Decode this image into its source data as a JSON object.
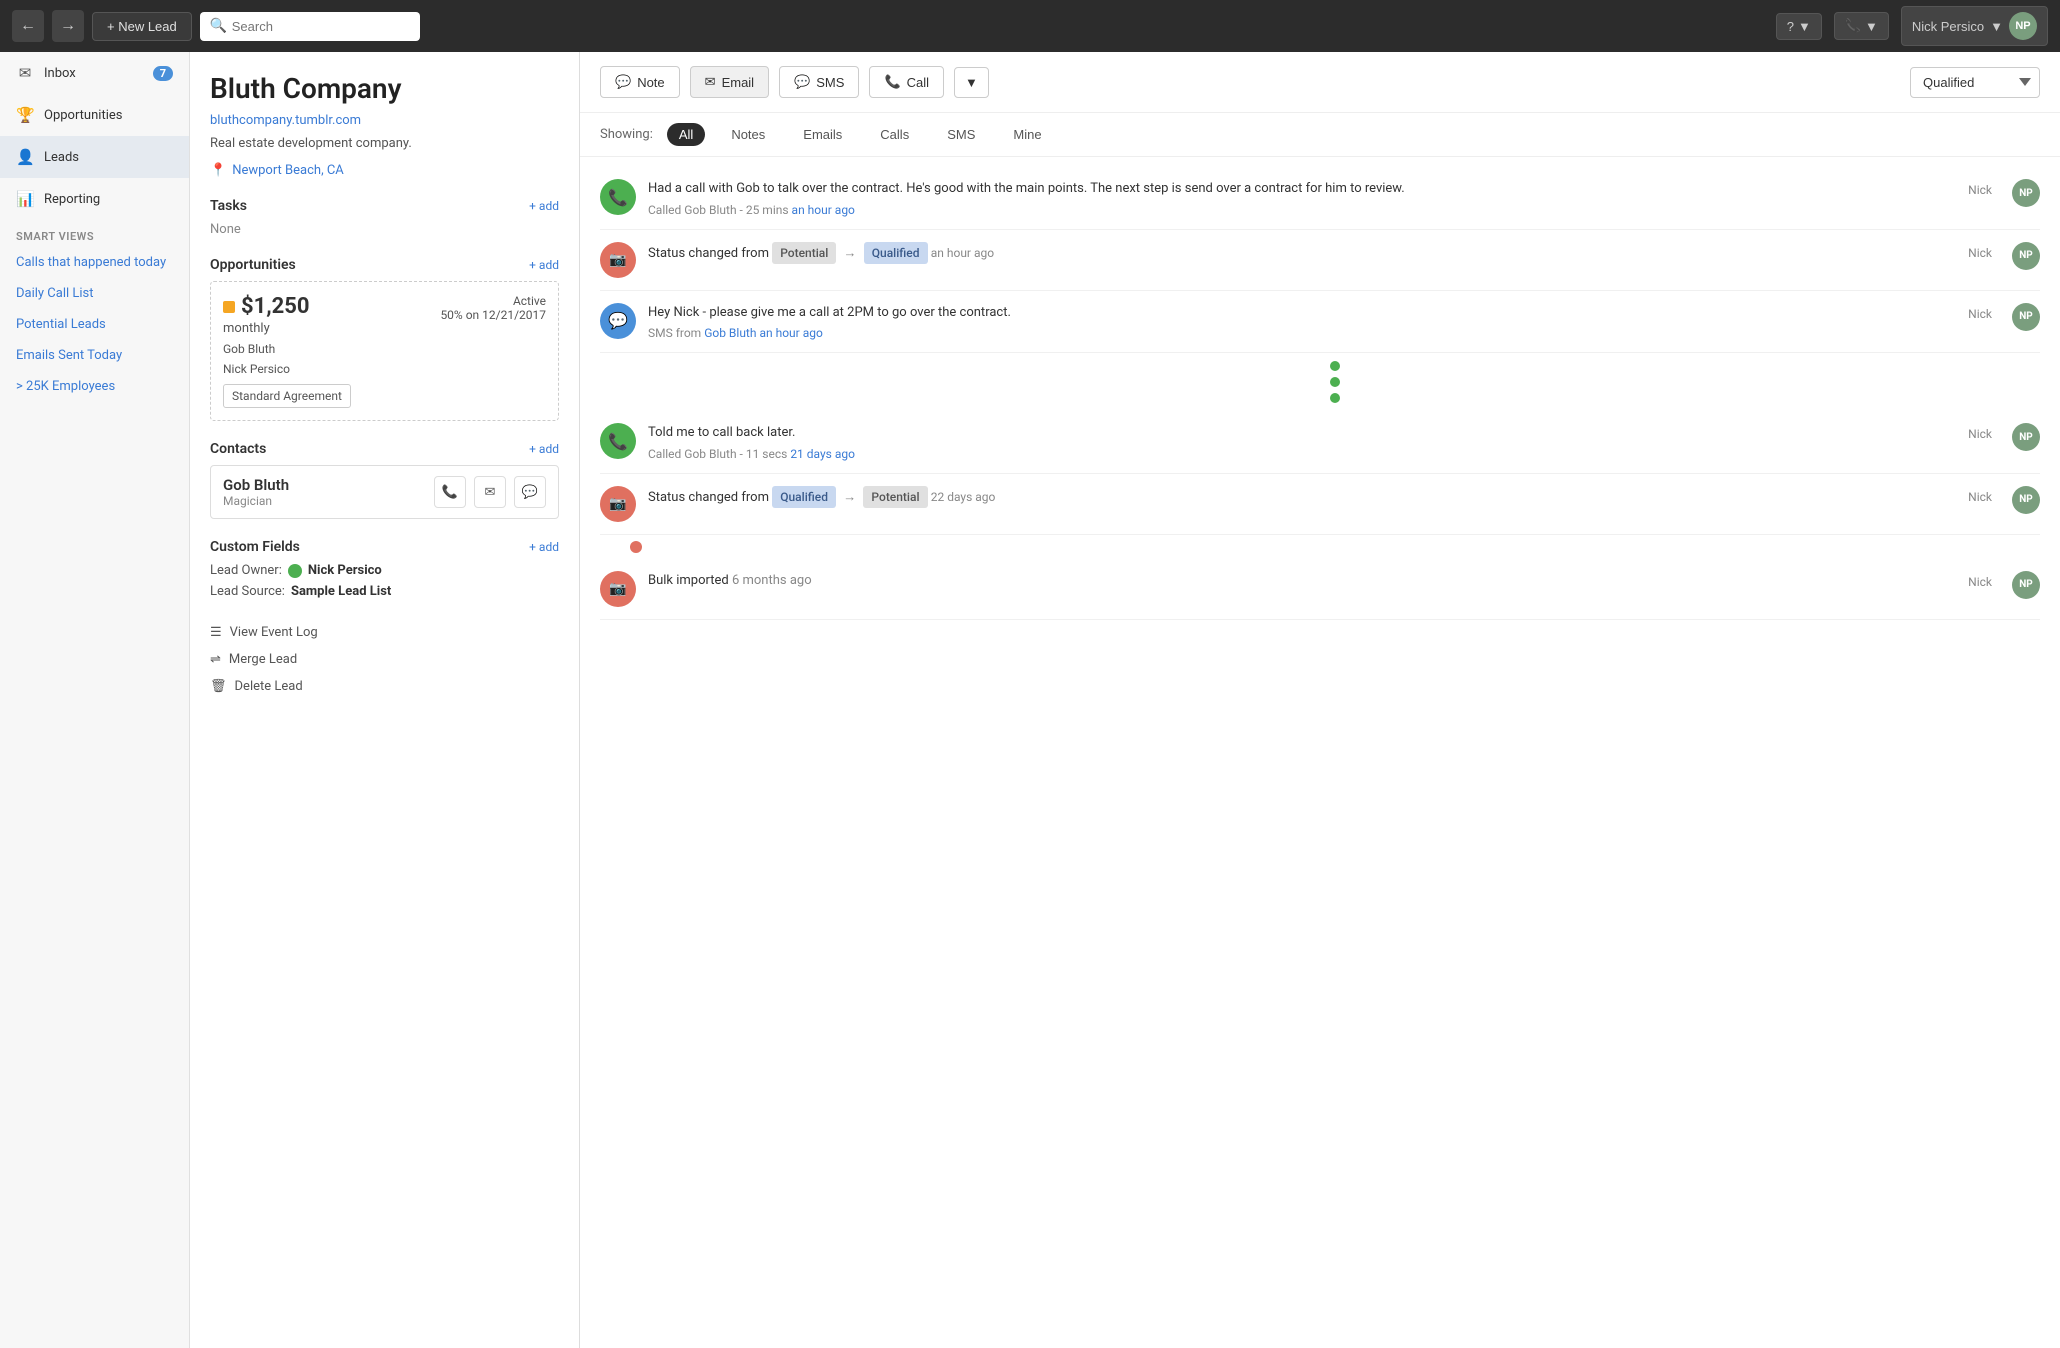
{
  "topnav": {
    "new_lead_label": "+ New Lead",
    "search_placeholder": "Search",
    "help_label": "?",
    "call_label": "📞",
    "user_name": "Nick Persico",
    "user_initials": "NP"
  },
  "sidebar": {
    "inbox_label": "Inbox",
    "inbox_badge": "7",
    "opportunities_label": "Opportunities",
    "leads_label": "Leads",
    "reporting_label": "Reporting",
    "smart_views_label": "SMART VIEWS",
    "smart_views": [
      {
        "label": "Calls that happened today"
      },
      {
        "label": "Daily Call List"
      },
      {
        "label": "Potential Leads"
      },
      {
        "label": "Emails Sent Today"
      },
      {
        "label": "> 25K Employees"
      }
    ]
  },
  "lead": {
    "company_name": "Bluth Company",
    "company_url": "bluthcompany.tumblr.com",
    "company_desc": "Real estate development company.",
    "location": "Newport Beach, CA",
    "tasks_label": "Tasks",
    "tasks_empty": "None",
    "opportunities_label": "Opportunities",
    "opportunity": {
      "amount": "$1,250",
      "period": "monthly",
      "status": "Active",
      "date": "50% on 12/21/2017",
      "contact1": "Gob Bluth",
      "contact2": "Nick Persico",
      "tag": "Standard Agreement"
    },
    "contacts_label": "Contacts",
    "contact": {
      "name": "Gob Bluth",
      "role": "Magician"
    },
    "custom_fields_label": "Custom Fields",
    "lead_owner_label": "Lead Owner:",
    "lead_owner_value": "Nick Persico",
    "lead_source_label": "Lead Source:",
    "lead_source_value": "Sample Lead List",
    "view_event_log": "View Event Log",
    "merge_lead": "Merge Lead",
    "delete_lead": "Delete Lead"
  },
  "activity": {
    "note_label": "Note",
    "email_label": "Email",
    "sms_label": "SMS",
    "call_label": "Call",
    "status_label": "Qualified",
    "filter_showing": "Showing:",
    "filters": [
      {
        "label": "All",
        "active": true
      },
      {
        "label": "Notes",
        "active": false
      },
      {
        "label": "Emails",
        "active": false
      },
      {
        "label": "Calls",
        "active": false
      },
      {
        "label": "SMS",
        "active": false
      },
      {
        "label": "Mine",
        "active": false
      }
    ],
    "items": [
      {
        "type": "call",
        "color": "green",
        "icon": "📞",
        "text": "Had a call with Gob to talk over the contract. He's good with the main points. The next step is send over a contract for him to review.",
        "meta": "Called Gob Bluth - 25 mins",
        "time": "an hour ago",
        "user": "Nick",
        "has_avatar": true
      },
      {
        "type": "status",
        "color": "salmon",
        "icon": "🔄",
        "text_prefix": "Status changed from",
        "from_status": "Potential",
        "to_status": "Qualified",
        "time": "an hour ago",
        "user": "Nick",
        "has_avatar": true
      },
      {
        "type": "sms",
        "color": "blue",
        "icon": "💬",
        "text": "Hey Nick - please give me a call at 2PM to go over the contract.",
        "meta": "SMS from",
        "meta_link": "Gob Bluth",
        "time": "an hour ago",
        "user": "Nick",
        "has_avatar": true
      },
      {
        "type": "dots",
        "dots": 3
      },
      {
        "type": "call",
        "color": "green",
        "icon": "📞",
        "text": "Told me to call back later.",
        "meta": "Called Gob Bluth - 11 secs",
        "time": "21 days ago",
        "user": "Nick",
        "has_avatar": true
      },
      {
        "type": "status",
        "color": "salmon",
        "icon": "🔄",
        "text_prefix": "Status changed from",
        "from_status": "Qualified",
        "to_status": "Potential",
        "time": "22 days ago",
        "user": "Nick",
        "has_avatar": true
      },
      {
        "type": "single_dot",
        "color": "salmon"
      },
      {
        "type": "status",
        "color": "salmon",
        "icon": "🔄",
        "text_prefix": "Bulk imported",
        "time": "6 months ago",
        "user": "Nick",
        "has_avatar": true
      }
    ]
  }
}
